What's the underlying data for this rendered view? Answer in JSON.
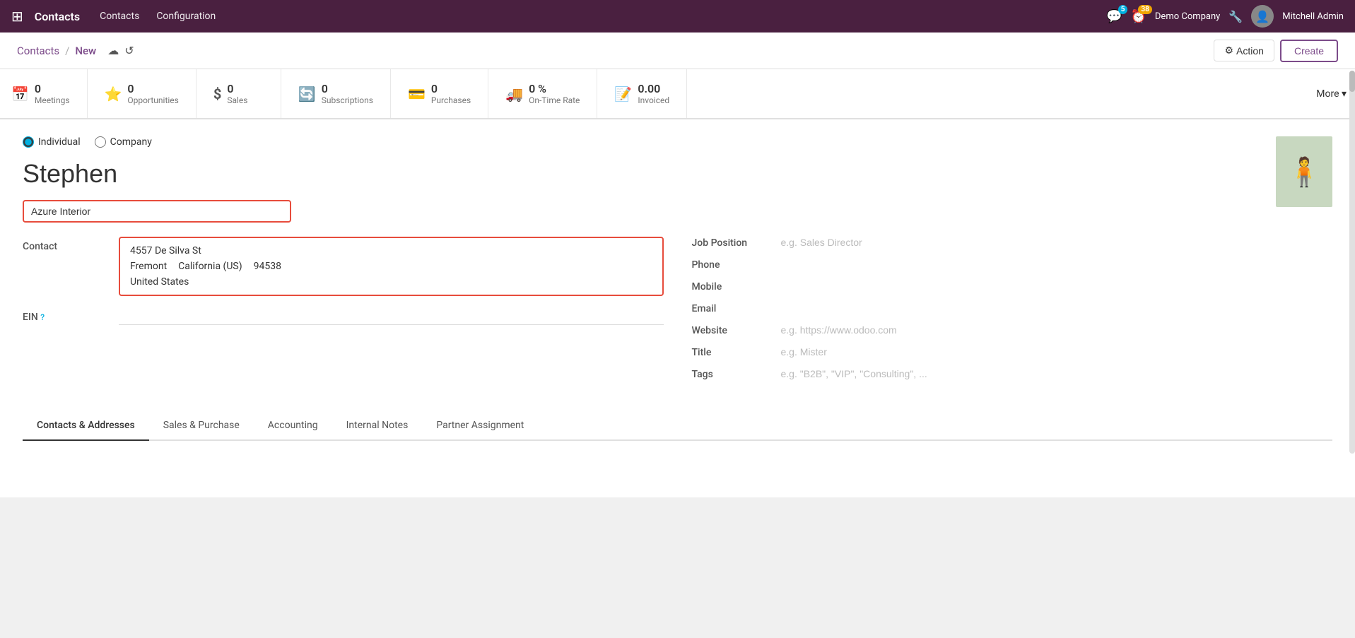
{
  "topnav": {
    "app_icon": "⊞",
    "app_name": "Contacts",
    "nav_links": [
      "Contacts",
      "Configuration"
    ],
    "messages_count": "5",
    "activities_count": "38",
    "company": "Demo Company",
    "user": "Mitchell Admin"
  },
  "breadcrumb": {
    "parent": "Contacts",
    "separator": "/",
    "current": "New",
    "cloud_icon": "☁",
    "refresh_icon": "↺"
  },
  "toolbar": {
    "action_label": "Action",
    "create_label": "Create"
  },
  "stats": [
    {
      "icon": "📅",
      "number": "0",
      "label": "Meetings"
    },
    {
      "icon": "⭐",
      "number": "0",
      "label": "Opportunities"
    },
    {
      "icon": "$",
      "number": "0",
      "label": "Sales"
    },
    {
      "icon": "🔄",
      "number": "0",
      "label": "Subscriptions"
    },
    {
      "icon": "💳",
      "number": "0",
      "label": "Purchases"
    },
    {
      "icon": "🚚",
      "number": "0 %",
      "label": "On-Time Rate"
    },
    {
      "icon": "📝",
      "number": "0.00",
      "label": "Invoiced"
    }
  ],
  "more_label": "More ▾",
  "form": {
    "individual_label": "Individual",
    "company_label": "Company",
    "contact_name": "Stephen",
    "company_name": "Azure Interior",
    "contact_label": "Contact",
    "address": {
      "street": "4557 De Silva St",
      "city": "Fremont",
      "state": "California (US)",
      "zip": "94538",
      "country": "United States"
    },
    "ein_label": "EIN",
    "ein_help": "?",
    "right_fields": [
      {
        "label": "Job Position",
        "value": "",
        "placeholder": "e.g. Sales Director"
      },
      {
        "label": "Phone",
        "value": "",
        "placeholder": ""
      },
      {
        "label": "Mobile",
        "value": "",
        "placeholder": ""
      },
      {
        "label": "Email",
        "value": "",
        "placeholder": ""
      },
      {
        "label": "Website",
        "value": "",
        "placeholder": "e.g. https://www.odoo.com"
      },
      {
        "label": "Title",
        "value": "",
        "placeholder": "e.g. Mister"
      },
      {
        "label": "Tags",
        "value": "",
        "placeholder": "e.g. \"B2B\", \"VIP\", \"Consulting\", ..."
      }
    ]
  },
  "tabs": [
    {
      "label": "Contacts & Addresses",
      "active": true
    },
    {
      "label": "Sales & Purchase",
      "active": false
    },
    {
      "label": "Accounting",
      "active": false
    },
    {
      "label": "Internal Notes",
      "active": false
    },
    {
      "label": "Partner Assignment",
      "active": false
    }
  ]
}
